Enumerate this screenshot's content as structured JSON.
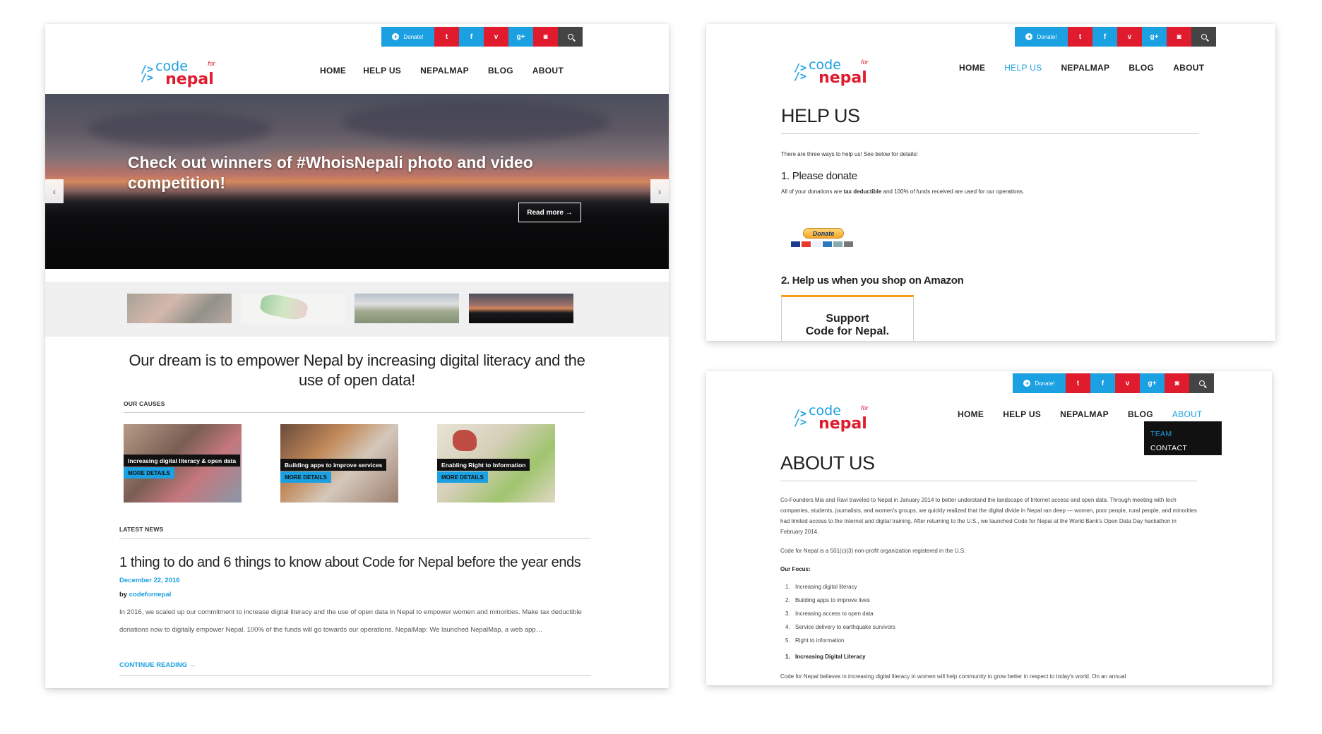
{
  "social": {
    "donate": "Donate!",
    "icons": [
      "twitter-icon",
      "facebook-icon",
      "vimeo-icon",
      "google-plus-icon",
      "instagram-icon",
      "search-icon"
    ],
    "glyphs": [
      "t",
      "f",
      "v",
      "g+",
      "◙",
      ""
    ]
  },
  "logo": {
    "arrows": "/>\n/>",
    "word1": "code",
    "for": "for",
    "word2": "nepal"
  },
  "nav": [
    "HOME",
    "HELP US",
    "NEPALMAP",
    "BLOG",
    "ABOUT"
  ],
  "home": {
    "hero_caption": "Check out winners of #WhoisNepali photo and video competition!",
    "read_more": "Read more →",
    "prev": "‹",
    "next": "›",
    "dream": "Our dream is to empower Nepal by increasing digital literacy and the use of open data!",
    "our_causes": "OUR CAUSES",
    "causes": [
      {
        "tag": "Increasing digital literacy & open data",
        "more": "MORE DETAILS"
      },
      {
        "tag": "Building apps to improve services",
        "more": "MORE DETAILS"
      },
      {
        "tag": "Enabling Right to Information",
        "more": "MORE DETAILS"
      }
    ],
    "latest_news": "LATEST NEWS",
    "news": {
      "title": "1 thing to do and 6 things to know about Code for Nepal before the year ends",
      "date": "December 22, 2016",
      "by": "by",
      "author": "codefornepal",
      "body": "In 2016, we scaled up our commitment to increase digital literacy and the use of open data in Nepal to empower women and minorities. Make tax deductible donations now to digitally empower Nepal. 100% of the funds will go towards our operations. NepalMap: We launched NepalMap, a web app…",
      "continue": "CONTINUE READING →"
    }
  },
  "help": {
    "title": "HELP US",
    "intro": "There are three ways to help us! See below for details!",
    "h1": "1. Please donate",
    "donate_text_pre": "All of your donations are ",
    "donate_text_bold": "tax deductible",
    "donate_text_post": " and 100% of funds received are used for our operations.",
    "paypal_button": "Donate",
    "h2": "2. Help us when you shop on Amazon",
    "amazon_line1": "Support",
    "amazon_line2": "Code for Nepal."
  },
  "about": {
    "title": "ABOUT US",
    "dropdown": [
      "TEAM",
      "CONTACT"
    ],
    "p1": "Co-Founders Mia and Ravi traveled to Nepal in January 2014 to better understand the landscape of Internet access and open data. Through meeting with tech companies, students, journalists, and women's groups, we quickly realized that the digital divide in Nepal ran deep — women, poor people, rural people, and minorities had limited access to the Internet and digital training. After returning to the U.S., we launched Code for Nepal at the World Bank's Open Data Day hackathon in February 2014.",
    "p2": "Code for Nepal is a 501(c)(3) non-profit organization registered in the U.S.",
    "focus_label": "Our Focus:",
    "focus": [
      {
        "n": "1.",
        "text": "Increasing digital literacy"
      },
      {
        "n": "2.",
        "text": "Building apps to improve lives"
      },
      {
        "n": "3.",
        "text": "Increasing access to open data"
      },
      {
        "n": "4.",
        "text": "Service delivery to earthquake survivors"
      },
      {
        "n": "5.",
        "text": "Right to information"
      }
    ],
    "sub_n": "1.",
    "sub_heading": "Increasing Digital Literacy",
    "p3": "Code for Nepal believes in increasing digital literacy in women will help community to grow better in respect to today's world. On an annual"
  }
}
